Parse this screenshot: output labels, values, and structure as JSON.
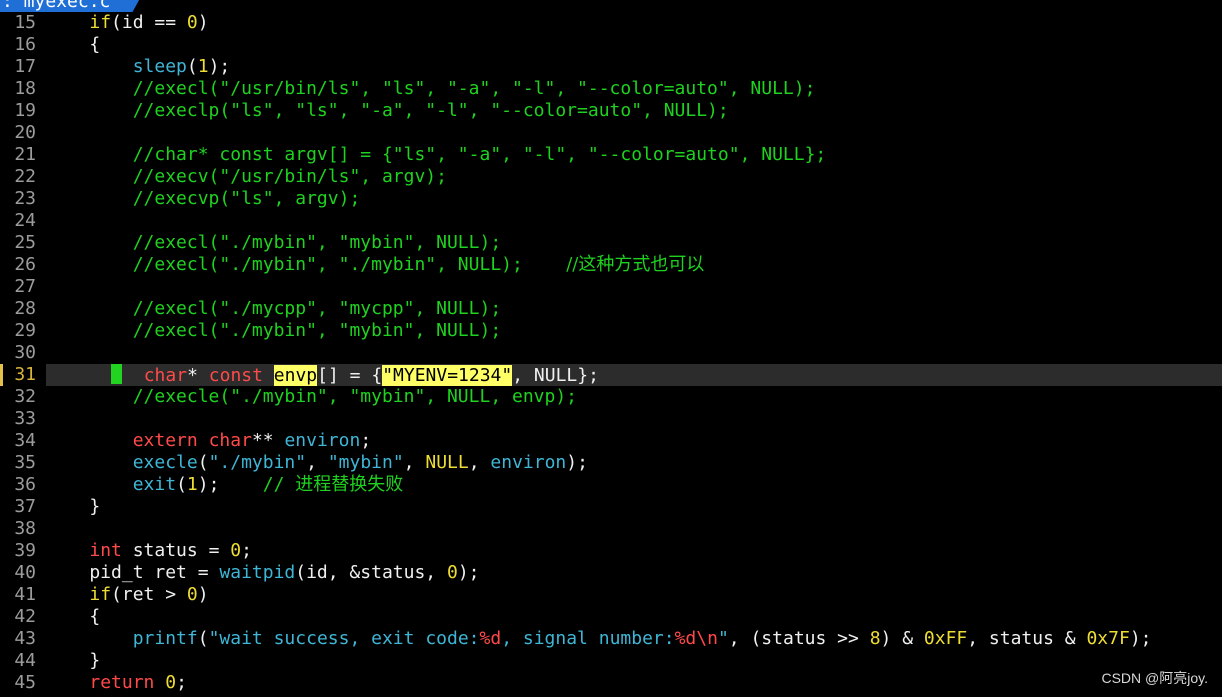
{
  "tab": {
    "title": ": myexec.c"
  },
  "watermark": "CSDN @阿亮joy.",
  "current_line": "31",
  "colors": {
    "background": "#000000",
    "keyword": "#eedd33",
    "type": "#ff4a4a",
    "function": "#3fb6d6",
    "comment": "#1fd21f",
    "line_number": "#9c9c9c",
    "search_highlight": "#ffff66",
    "tab_accent": "#1f6fd6"
  },
  "lines": [
    {
      "n": "15",
      "tokens": [
        [
          "plain",
          "    "
        ],
        [
          "kw",
          "if"
        ],
        [
          "plain",
          "(id == "
        ],
        [
          "num",
          "0"
        ],
        [
          "plain",
          ")"
        ]
      ]
    },
    {
      "n": "16",
      "tokens": [
        [
          "plain",
          "    {"
        ]
      ]
    },
    {
      "n": "17",
      "tokens": [
        [
          "plain",
          "        "
        ],
        [
          "fn",
          "sleep"
        ],
        [
          "plain",
          "("
        ],
        [
          "num",
          "1"
        ],
        [
          "plain",
          ");"
        ]
      ]
    },
    {
      "n": "18",
      "tokens": [
        [
          "plain",
          "        "
        ],
        [
          "cmt",
          "//execl(\"/usr/bin/ls\", \"ls\", \"-a\", \"-l\", \"--color=auto\", NULL);"
        ]
      ]
    },
    {
      "n": "19",
      "tokens": [
        [
          "plain",
          "        "
        ],
        [
          "cmt",
          "//execlp(\"ls\", \"ls\", \"-a\", \"-l\", \"--color=auto\", NULL);"
        ]
      ]
    },
    {
      "n": "20",
      "tokens": []
    },
    {
      "n": "21",
      "tokens": [
        [
          "plain",
          "        "
        ],
        [
          "cmt",
          "//char* const argv[] = {\"ls\", \"-a\", \"-l\", \"--color=auto\", NULL};"
        ]
      ]
    },
    {
      "n": "22",
      "tokens": [
        [
          "plain",
          "        "
        ],
        [
          "cmt",
          "//execv(\"/usr/bin/ls\", argv);"
        ]
      ]
    },
    {
      "n": "23",
      "tokens": [
        [
          "plain",
          "        "
        ],
        [
          "cmt",
          "//execvp(\"ls\", argv);"
        ]
      ]
    },
    {
      "n": "24",
      "tokens": []
    },
    {
      "n": "25",
      "tokens": [
        [
          "plain",
          "        "
        ],
        [
          "cmt",
          "//execl(\"./mybin\", \"mybin\", NULL);"
        ]
      ]
    },
    {
      "n": "26",
      "tokens": [
        [
          "plain",
          "        "
        ],
        [
          "cmt",
          "//execl(\"./mybin\", \"./mybin\", NULL);    "
        ],
        [
          "cmt cjk",
          "//这种方式也可以"
        ]
      ]
    },
    {
      "n": "27",
      "tokens": []
    },
    {
      "n": "28",
      "tokens": [
        [
          "plain",
          "        "
        ],
        [
          "cmt",
          "//execl(\"./mycpp\", \"mycpp\", NULL);"
        ]
      ]
    },
    {
      "n": "29",
      "tokens": [
        [
          "plain",
          "        "
        ],
        [
          "cmt",
          "//execl(\"./mybin\", \"mybin\", NULL);"
        ]
      ]
    },
    {
      "n": "30",
      "tokens": []
    },
    {
      "n": "31",
      "current": true,
      "tokens": [
        [
          "plain",
          "      "
        ],
        [
          "cursor",
          ""
        ],
        [
          "plain",
          "  "
        ],
        [
          "type",
          "char"
        ],
        [
          "plain",
          "* "
        ],
        [
          "type",
          "const"
        ],
        [
          "plain",
          " "
        ],
        [
          "hl",
          "envp"
        ],
        [
          "plain",
          "[] = {"
        ],
        [
          "hlstr",
          "\"MYENV=1234\""
        ],
        [
          "plain",
          ", NULL};"
        ]
      ]
    },
    {
      "n": "32",
      "tokens": [
        [
          "plain",
          "        "
        ],
        [
          "cmt",
          "//execle(\"./mybin\", \"mybin\", NULL, envp);"
        ]
      ]
    },
    {
      "n": "33",
      "tokens": []
    },
    {
      "n": "34",
      "tokens": [
        [
          "plain",
          "        "
        ],
        [
          "type",
          "extern"
        ],
        [
          "plain",
          " "
        ],
        [
          "type",
          "char"
        ],
        [
          "plain",
          "** "
        ],
        [
          "fn",
          "environ"
        ],
        [
          "plain",
          ";"
        ]
      ]
    },
    {
      "n": "35",
      "tokens": [
        [
          "plain",
          "        "
        ],
        [
          "fn",
          "execle"
        ],
        [
          "plain",
          "("
        ],
        [
          "str",
          "\"./mybin\""
        ],
        [
          "plain",
          ", "
        ],
        [
          "str",
          "\"mybin\""
        ],
        [
          "plain",
          ", "
        ],
        [
          "num",
          "NULL"
        ],
        [
          "plain",
          ", "
        ],
        [
          "fn",
          "environ"
        ],
        [
          "plain",
          ");"
        ]
      ]
    },
    {
      "n": "36",
      "tokens": [
        [
          "plain",
          "        "
        ],
        [
          "fn",
          "exit"
        ],
        [
          "plain",
          "("
        ],
        [
          "num",
          "1"
        ],
        [
          "plain",
          ");    "
        ],
        [
          "cmt",
          "// "
        ],
        [
          "cmt cjk",
          "进程替换失败"
        ]
      ]
    },
    {
      "n": "37",
      "tokens": [
        [
          "plain",
          "    }"
        ]
      ]
    },
    {
      "n": "38",
      "tokens": []
    },
    {
      "n": "39",
      "tokens": [
        [
          "plain",
          "    "
        ],
        [
          "type",
          "int"
        ],
        [
          "plain",
          " status = "
        ],
        [
          "num",
          "0"
        ],
        [
          "plain",
          ";"
        ]
      ]
    },
    {
      "n": "40",
      "tokens": [
        [
          "plain",
          "    pid_t ret = "
        ],
        [
          "fn",
          "waitpid"
        ],
        [
          "plain",
          "(id, &status, "
        ],
        [
          "num",
          "0"
        ],
        [
          "plain",
          ");"
        ]
      ]
    },
    {
      "n": "41",
      "tokens": [
        [
          "plain",
          "    "
        ],
        [
          "kw",
          "if"
        ],
        [
          "plain",
          "(ret > "
        ],
        [
          "num",
          "0"
        ],
        [
          "plain",
          ")"
        ]
      ]
    },
    {
      "n": "42",
      "tokens": [
        [
          "plain",
          "    {"
        ]
      ]
    },
    {
      "n": "43",
      "tokens": [
        [
          "plain",
          "        "
        ],
        [
          "fn",
          "printf"
        ],
        [
          "plain",
          "("
        ],
        [
          "str",
          "\"wait success, exit code:"
        ],
        [
          "type",
          "%d"
        ],
        [
          "str",
          ", signal number:"
        ],
        [
          "type",
          "%d\\n"
        ],
        [
          "str",
          "\""
        ],
        [
          "plain",
          ", (status >> "
        ],
        [
          "num",
          "8"
        ],
        [
          "plain",
          ") & "
        ],
        [
          "num",
          "0xFF"
        ],
        [
          "plain",
          ", status & "
        ],
        [
          "num",
          "0x7F"
        ],
        [
          "plain",
          ");"
        ]
      ]
    },
    {
      "n": "44",
      "tokens": [
        [
          "plain",
          "    }"
        ]
      ]
    },
    {
      "n": "45",
      "tokens": [
        [
          "plain",
          "    "
        ],
        [
          "type",
          "return"
        ],
        [
          "plain",
          " "
        ],
        [
          "num",
          "0"
        ],
        [
          "plain",
          ";"
        ]
      ]
    }
  ]
}
